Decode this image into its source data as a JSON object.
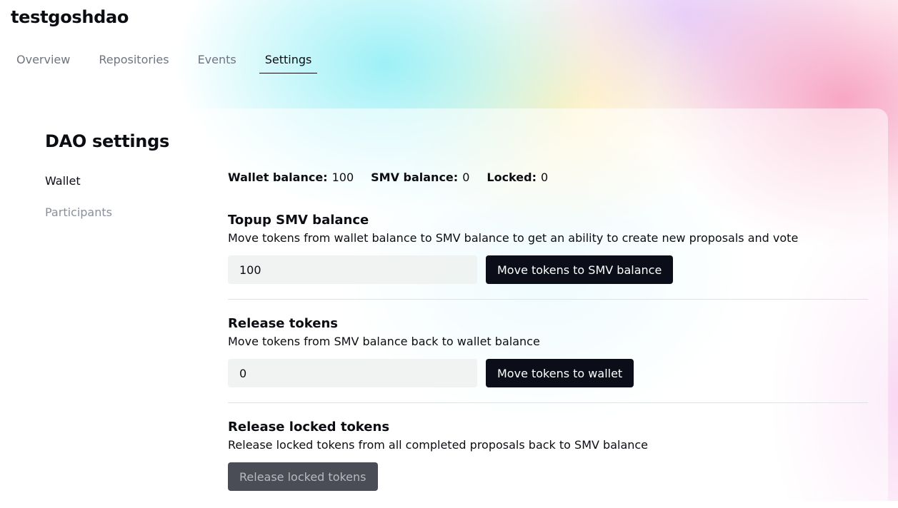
{
  "header": {
    "org_name": "testgoshdao",
    "tabs": [
      {
        "label": "Overview"
      },
      {
        "label": "Repositories"
      },
      {
        "label": "Events"
      },
      {
        "label": "Settings"
      }
    ]
  },
  "settings": {
    "title": "DAO settings",
    "nav": [
      {
        "label": "Wallet"
      },
      {
        "label": "Participants"
      }
    ],
    "balances": {
      "wallet_label": "Wallet balance:",
      "wallet_value": "100",
      "smv_label": "SMV balance:",
      "smv_value": "0",
      "locked_label": "Locked:",
      "locked_value": "0"
    },
    "topup": {
      "title": "Topup SMV balance",
      "description": "Move tokens from wallet balance to SMV balance to get an ability to create new proposals and vote",
      "input_value": "100",
      "button_label": "Move tokens to SMV balance"
    },
    "release": {
      "title": "Release tokens",
      "description": "Move tokens from SMV balance back to wallet balance",
      "input_value": "0",
      "button_label": "Move tokens to wallet"
    },
    "release_locked": {
      "title": "Release locked tokens",
      "description": "Release locked tokens from all completed proposals back to SMV balance",
      "button_label": "Release locked tokens"
    }
  },
  "colors": {
    "text": "#0b0d12",
    "muted": "#8a8f99",
    "button_bg": "#0b0d18",
    "button_disabled_bg": "#4a4d55"
  }
}
